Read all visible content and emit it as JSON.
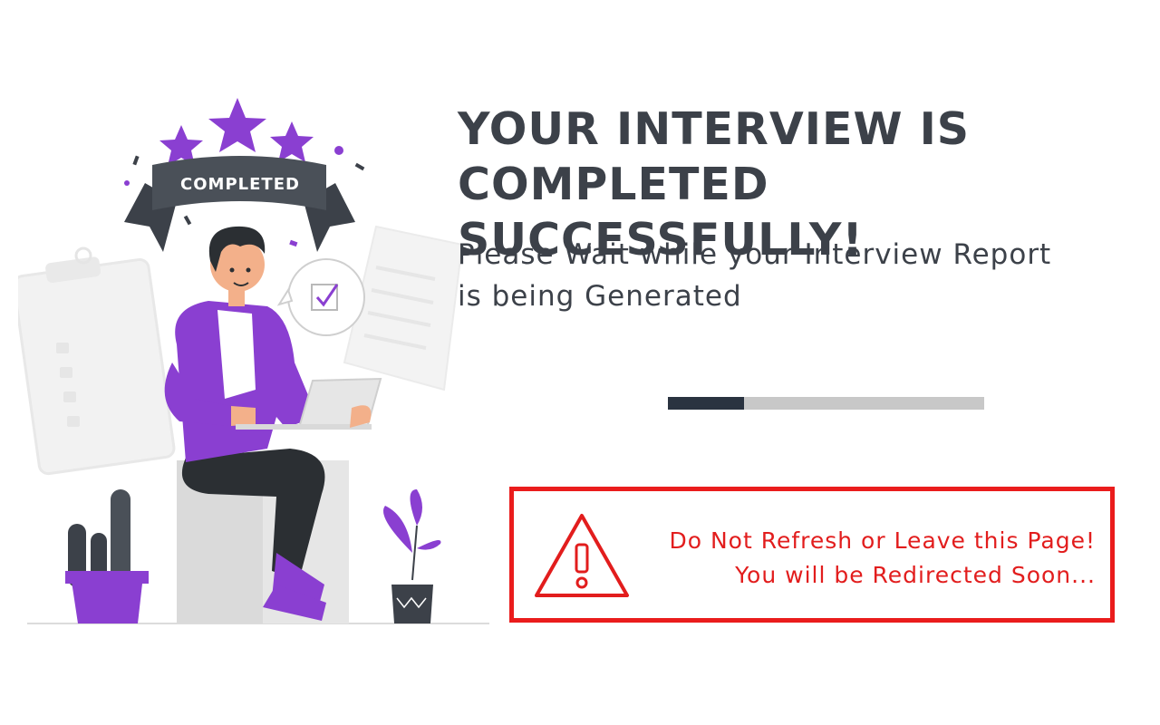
{
  "illustration": {
    "banner_label": "COMPLETED",
    "accent_color": "#8a3fd1",
    "icons": [
      "star-icon",
      "clipboard-icon",
      "checkmark-icon",
      "document-icon",
      "laptop-icon",
      "cactus-icon",
      "plant-icon"
    ]
  },
  "headline": {
    "line1": "YOUR INTERVIEW IS",
    "line2": "COMPLETED SUCCESSFULLY!"
  },
  "subtitle": {
    "line1": "Please Wait while your Interview Report",
    "line2": "is being Generated"
  },
  "progress": {
    "fraction": 0.24,
    "fill_color": "#2a3340",
    "track_color": "#c8c8c8"
  },
  "warning": {
    "icon": "warning-triangle-icon",
    "line1": "Do Not Refresh or Leave this Page!",
    "line2": "You will be Redirected Soon...",
    "color": "#e21d1d"
  }
}
